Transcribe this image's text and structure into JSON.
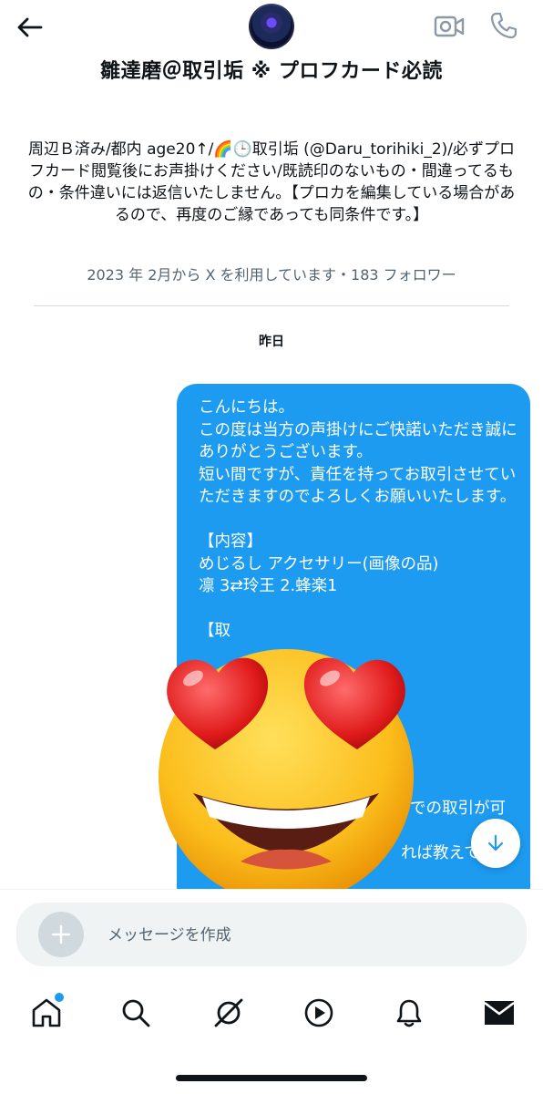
{
  "header": {
    "title": "雛達磨＠取引垢 ※ プロフカード必読",
    "back_icon": "arrow-left-icon",
    "video_icon": "video-camera-icon",
    "call_icon": "phone-icon"
  },
  "profile": {
    "bio": "周辺Ｂ済み/都内 age20↑/🌈🕒取引垢 (@Daru_torihiki_2)/必ずプロフカード閲覧後にお声掛けください/既読印のないもの・間違ってるもの・条件違いには返信いたしません。【プロカを編集している場合があるので、再度のご縁であっても同条件です。】",
    "meta": "2023 年 2月から X を利用しています・183 フォロワー"
  },
  "conversation": {
    "date_separator": "昨日",
    "message_text": "こんにちは。\nこの度は当方の声掛けにご快諾いただき誠にありがとうございます。\n短い間ですが、責任を持ってお取引させていただきますのでよろしくお願いいたします。\n\n【内容】\nめじるし アクセサリー(画像の品)\n凛 3⇄玲王 2.蜂楽1\n\n【取",
    "partial_1": "での取引が可",
    "partial_2": "れば教えて",
    "sticker": "smiling-face-with-heart-eyes-emoji"
  },
  "composer": {
    "placeholder": "メッセージを作成",
    "add_icon": "plus-icon",
    "voice_icon": "voice-wave-icon"
  },
  "tabs": [
    {
      "name": "home",
      "icon": "home-icon",
      "has_notification": true
    },
    {
      "name": "search",
      "icon": "search-icon"
    },
    {
      "name": "grok",
      "icon": "grok-icon"
    },
    {
      "name": "video",
      "icon": "play-icon"
    },
    {
      "name": "notifications",
      "icon": "bell-icon"
    },
    {
      "name": "messages",
      "icon": "envelope-icon"
    }
  ],
  "colors": {
    "accent": "#1d9bf0",
    "text": "#0f1419",
    "secondary_text": "#536471",
    "composer_bg": "#eff3f4"
  }
}
